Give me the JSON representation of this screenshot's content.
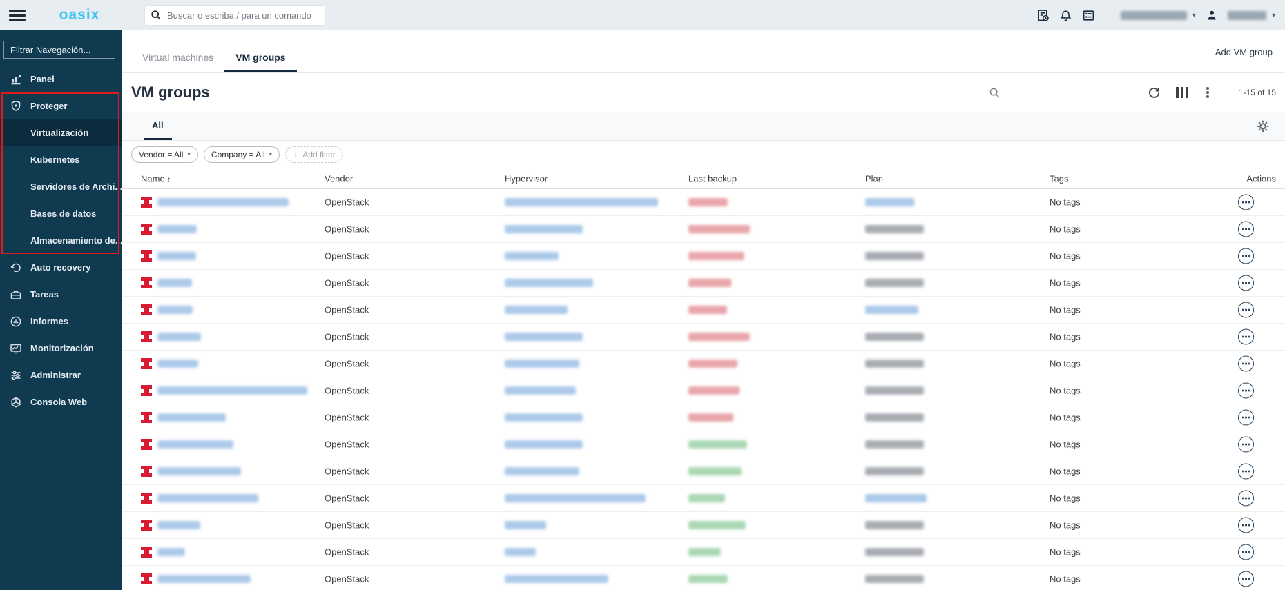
{
  "header": {
    "logo": "oasix",
    "search_placeholder": "Buscar o escriba / para un comando",
    "icons": [
      "jobs-icon",
      "notifications-bell-icon",
      "actions-list-icon",
      "user-avatar-icon"
    ],
    "company_selector_blurred": true,
    "user_name_blurred": true
  },
  "sidebar": {
    "filter_placeholder": "Filtrar Navegación...",
    "items": [
      {
        "label": "Panel",
        "icon": "dashboard"
      },
      {
        "label": "Proteger",
        "icon": "shield"
      },
      {
        "label": "Virtualización",
        "sub": true,
        "active": true
      },
      {
        "label": "Kubernetes",
        "sub": true
      },
      {
        "label": "Servidores de Archi...",
        "sub": true
      },
      {
        "label": "Bases de datos",
        "sub": true
      },
      {
        "label": "Almacenamiento de...",
        "sub": true
      },
      {
        "label": "Auto recovery",
        "icon": "recovery"
      },
      {
        "label": "Tareas",
        "icon": "briefcase"
      },
      {
        "label": "Informes",
        "icon": "reports"
      },
      {
        "label": "Monitorización",
        "icon": "monitor"
      },
      {
        "label": "Administrar",
        "icon": "sliders"
      },
      {
        "label": "Consola Web",
        "icon": "globe"
      }
    ],
    "highlight_box_items": [
      "Proteger",
      "Virtualización",
      "Kubernetes",
      "Servidores de Archi...",
      "Bases de datos",
      "Almacenamiento de..."
    ]
  },
  "tabs": {
    "items": [
      "Virtual machines",
      "VM groups"
    ],
    "active_index": 1,
    "action_label": "Add VM group"
  },
  "main": {
    "title": "VM groups",
    "pagination": "1-15 of 15",
    "view_tab": "All",
    "filters": [
      {
        "label": "Vendor = All"
      },
      {
        "label": "Company = All"
      }
    ],
    "add_filter_label": "Add filter",
    "table": {
      "columns": [
        "Name",
        "Vendor",
        "Hypervisor",
        "Last backup",
        "Plan",
        "Tags",
        "Actions"
      ],
      "sort": {
        "column": "Name",
        "direction": "asc"
      },
      "rows": [
        {
          "vendor": "OpenStack",
          "tags": "No tags",
          "name_w": 190,
          "hypervisor_w": 222,
          "backup_w": 57,
          "backup_status": "failed",
          "plan_w": 71,
          "plan_kind": "link"
        },
        {
          "vendor": "OpenStack",
          "tags": "No tags",
          "name_w": 57,
          "hypervisor_w": 113,
          "backup_w": 89,
          "backup_status": "failed",
          "plan_w": 85,
          "plan_kind": "text"
        },
        {
          "vendor": "OpenStack",
          "tags": "No tags",
          "name_w": 56,
          "hypervisor_w": 78,
          "backup_w": 81,
          "backup_status": "failed",
          "plan_w": 85,
          "plan_kind": "text"
        },
        {
          "vendor": "OpenStack",
          "tags": "No tags",
          "name_w": 50,
          "hypervisor_w": 128,
          "backup_w": 62,
          "backup_status": "failed",
          "plan_w": 85,
          "plan_kind": "text"
        },
        {
          "vendor": "OpenStack",
          "tags": "No tags",
          "name_w": 51,
          "hypervisor_w": 91,
          "backup_w": 56,
          "backup_status": "failed",
          "plan_w": 77,
          "plan_kind": "link"
        },
        {
          "vendor": "OpenStack",
          "tags": "No tags",
          "name_w": 63,
          "hypervisor_w": 113,
          "backup_w": 89,
          "backup_status": "failed",
          "plan_w": 85,
          "plan_kind": "text"
        },
        {
          "vendor": "OpenStack",
          "tags": "No tags",
          "name_w": 59,
          "hypervisor_w": 108,
          "backup_w": 71,
          "backup_status": "failed",
          "plan_w": 85,
          "plan_kind": "text"
        },
        {
          "vendor": "OpenStack",
          "tags": "No tags",
          "name_w": 217,
          "hypervisor_w": 103,
          "backup_w": 74,
          "backup_status": "failed",
          "plan_w": 85,
          "plan_kind": "text"
        },
        {
          "vendor": "OpenStack",
          "tags": "No tags",
          "name_w": 99,
          "hypervisor_w": 113,
          "backup_w": 65,
          "backup_status": "failed",
          "plan_w": 85,
          "plan_kind": "text"
        },
        {
          "vendor": "OpenStack",
          "tags": "No tags",
          "name_w": 110,
          "hypervisor_w": 113,
          "backup_w": 85,
          "backup_status": "success",
          "plan_w": 85,
          "plan_kind": "text"
        },
        {
          "vendor": "OpenStack",
          "tags": "No tags",
          "name_w": 121,
          "hypervisor_w": 108,
          "backup_w": 77,
          "backup_status": "success",
          "plan_w": 85,
          "plan_kind": "text"
        },
        {
          "vendor": "OpenStack",
          "tags": "No tags",
          "name_w": 146,
          "hypervisor_w": 204,
          "backup_w": 53,
          "backup_status": "success",
          "plan_w": 89,
          "plan_kind": "link"
        },
        {
          "vendor": "OpenStack",
          "tags": "No tags",
          "name_w": 62,
          "hypervisor_w": 60,
          "backup_w": 83,
          "backup_status": "success",
          "plan_w": 85,
          "plan_kind": "text"
        },
        {
          "vendor": "OpenStack",
          "tags": "No tags",
          "name_w": 40,
          "hypervisor_w": 45,
          "backup_w": 47,
          "backup_status": "success",
          "plan_w": 85,
          "plan_kind": "text"
        },
        {
          "vendor": "OpenStack",
          "tags": "No tags",
          "name_w": 135,
          "hypervisor_w": 150,
          "backup_w": 57,
          "backup_status": "success",
          "plan_w": 85,
          "plan_kind": "text"
        }
      ]
    }
  },
  "colors": {
    "sidebar_bg": "#0f3a50",
    "sidebar_active": "#0b2c3e",
    "logo": "#3fc6f2",
    "highlight_red": "#e01a1a",
    "accent_dark": "#17293e",
    "openstack_red": "#da1a32",
    "link_blur": "#adc9ea",
    "failed_blur": "#e9a6aa",
    "success_blur": "#abd8b4",
    "neutral_blur": "#a9adb2",
    "header_blur": "#9aa6b0"
  }
}
